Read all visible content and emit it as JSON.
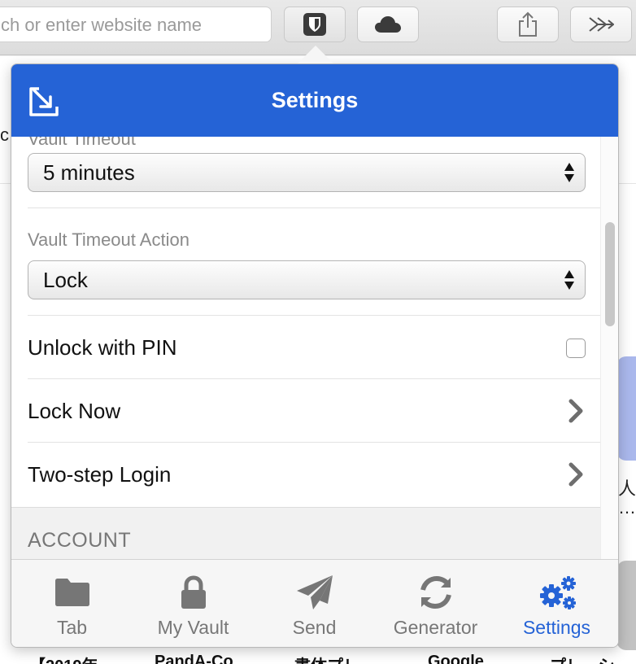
{
  "browser": {
    "address_placeholder": "ch or enter website name",
    "buttons": [
      "bitwarden-extension",
      "cloud",
      "share",
      "more"
    ]
  },
  "background_page": {
    "left_char": "c",
    "right_chars": [
      "人",
      "…"
    ],
    "bottom_strip": [
      "【2019年",
      "PandA-Co",
      "書体プレ",
      "Google",
      "プレーシ"
    ]
  },
  "popup": {
    "title": "Settings",
    "top_label_partial": "Vault Timeout",
    "vault_timeout": {
      "value": "5 minutes"
    },
    "vault_timeout_action": {
      "label": "Vault Timeout Action",
      "value": "Lock"
    },
    "rows": [
      {
        "label": "Unlock with PIN",
        "control": "checkbox",
        "checked": false
      },
      {
        "label": "Lock Now",
        "control": "chevron"
      },
      {
        "label": "Two-step Login",
        "control": "chevron"
      }
    ],
    "section_account": "ACCOUNT",
    "tabs": [
      {
        "label": "Tab",
        "icon": "folder-icon",
        "active": false
      },
      {
        "label": "My Vault",
        "icon": "lock-icon",
        "active": false
      },
      {
        "label": "Send",
        "icon": "paper-plane-icon",
        "active": false
      },
      {
        "label": "Generator",
        "icon": "refresh-icon",
        "active": false
      },
      {
        "label": "Settings",
        "icon": "gears-icon",
        "active": true
      }
    ],
    "colors": {
      "accent": "#2563d6",
      "inactive_tab": "#777777"
    }
  }
}
